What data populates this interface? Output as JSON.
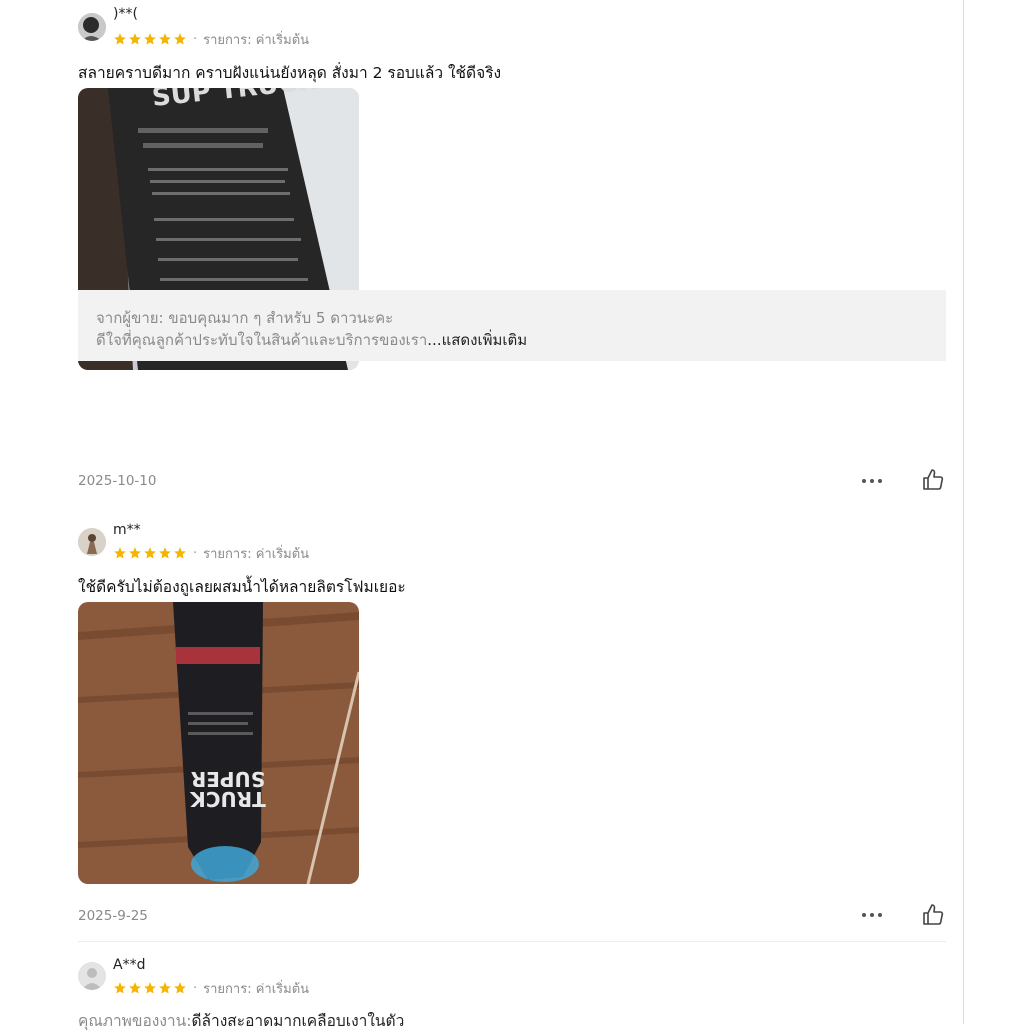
{
  "reviews": [
    {
      "username": ")**(",
      "rating": 5,
      "variant": "รายการ: ค่าเริ่มต้น",
      "text": "สลายคราบดีมาก คราบฝังแน่นยังหลุด สั่งมา 2 รอบแล้ว ใช้ดีจริง",
      "seller_reply_line1": "จากผู้ขาย: ขอบคุณมาก ๆ สำหรับ 5 ดาวนะคะ",
      "seller_reply_line2": "ดีใจที่คุณลูกค้าประทับใจในสินค้าและบริการของเรา",
      "seller_reply_more": "...แสดงเพิ่มเติม",
      "date": "2025-10-10"
    },
    {
      "username": "m**",
      "rating": 5,
      "variant": "รายการ: ค่าเริ่มต้น",
      "text": "ใช้ดีครับไม่ต้องถูเลยผสมน้ำได้หลายลิตรโฟมเยอะ",
      "date": "2025-9-25"
    },
    {
      "username": "A**d",
      "rating": 5,
      "variant": "รายการ: ค่าเริ่มต้น",
      "text_label": "คุณภาพของงาน:",
      "text_value": "ดีล้างสะอาดมากเคลือบเงาในตัว"
    }
  ],
  "icons": {
    "star": "star-icon",
    "more": "more-icon",
    "like": "thumbs-up-icon"
  },
  "colors": {
    "star": "#f5b400",
    "muted": "#8a8a8a",
    "reply_bg": "#f2f2f2"
  }
}
